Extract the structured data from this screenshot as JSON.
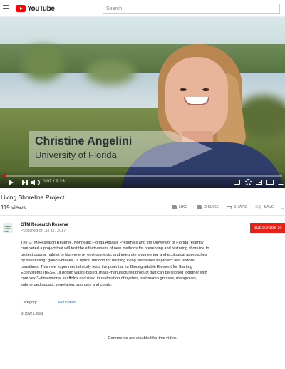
{
  "header": {
    "logo_text": "YouTube",
    "search_placeholder": "Search"
  },
  "player": {
    "caption_name": "Christine Angelini",
    "caption_affiliation": "University of Florida",
    "time_display": "0:07 / 9:23",
    "progress": 0.012,
    "progress_color": "#ff0000"
  },
  "video": {
    "title": "Living Shoreline Project",
    "views": "119 views",
    "actions": {
      "like": "LIKE",
      "dislike": "DISLIKE",
      "share": "SHARE",
      "save": "SAVE"
    }
  },
  "channel": {
    "name": "GTM Research Reserve",
    "published": "Published on Jul 17, 2017",
    "subscribe_label": "SUBSCRIBE 10",
    "subscribe_color": "#e62117",
    "avatar_tag": "GTM"
  },
  "description": {
    "text": "The GTM Research Reserve, Northeast Florida Aquatic Preserves and the University of Florida recently completed a project that will test the effectiveness of new methods for preserving and restoring shoreline to protect coastal habitat in high-energy environments, and integrate engineering and ecological approaches by developing “gabion-breaks,” a hybrid method for building living shorelines to protect and restore coastlines. This new experimental study tests the potential for Biodegradable Element for Starting Ecosystems (BESE), a potato waste-based, mass-manufactured product that can be clipped together with complex 3-dimensional scaffolds and used in restoration of oysters, salt marsh grasses, mangroves, submerged aquatic vegetation, sponges and corals.",
    "category_label": "Category",
    "category_value": "Education",
    "show_less": "SHOW LESS"
  },
  "comments": {
    "disabled_text": "Comments are disabled for this video."
  }
}
